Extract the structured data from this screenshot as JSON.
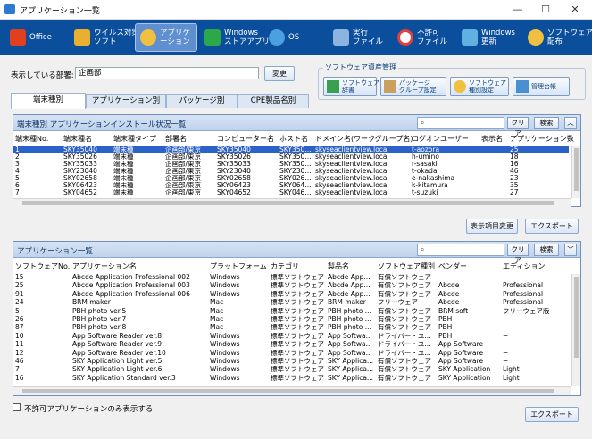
{
  "window": {
    "title": "アプリケーション一覧",
    "controls": [
      "—",
      "☐",
      "✕"
    ]
  },
  "ribbon": [
    {
      "label": "Office",
      "icon": "office-icon",
      "color": "#e04020"
    },
    {
      "label": "ウイルス対策\nソフト",
      "icon": "antivirus-icon",
      "color": "#e8b030"
    },
    {
      "label": "アプリケーション",
      "icon": "application-icon",
      "color": "#f0c040",
      "active": true
    },
    {
      "label": "Windows\nストアアプリ",
      "icon": "store-icon",
      "color": "#2aa84a"
    },
    {
      "label": "OS",
      "icon": "os-icon",
      "color": "#4aa0e0"
    },
    {
      "label": "実行\nファイル",
      "icon": "executable-icon",
      "color": "#8db3e0"
    },
    {
      "label": "不許可\nファイル",
      "icon": "forbidden-icon",
      "color": "#e04040"
    },
    {
      "label": "Windows\n更新",
      "icon": "windows-update-icon",
      "color": "#60b0e0"
    },
    {
      "label": "ソフトウェア\n配布",
      "icon": "distribution-icon",
      "color": "#f0c040"
    }
  ],
  "dept": {
    "label": "表示している部署:",
    "value": "企画部",
    "change_button": "変更"
  },
  "asset": {
    "group_label": "ソフトウェア資産管理",
    "buttons": [
      {
        "label": "ソフトウェア\n辞書",
        "icon": "dictionary-icon"
      },
      {
        "label": "パッケージ\nグループ設定",
        "icon": "package-group-icon"
      },
      {
        "label": "ソフトウェア\n種別設定",
        "icon": "software-type-icon"
      },
      {
        "label": "管理台帳",
        "icon": "ledger-icon"
      }
    ]
  },
  "tabs": [
    "端末種別",
    "アプリケーション別",
    "パッケージ別",
    "CPE製品名別"
  ],
  "top_panel": {
    "title": "端末種別 アプリケーションインストール状況一覧",
    "clear": "クリア",
    "search": "検索",
    "columns": [
      "端末種No.",
      "端末種名",
      "端末種タイプ",
      "部署名",
      "コンピューター名",
      "ホスト名",
      "ドメイン名(ワークグループ名)",
      "ログオンユーザー",
      "表示名",
      "アプリケーション数"
    ],
    "rows": [
      [
        "1",
        "SKY35040",
        "端末種",
        "企画部/東京",
        "SKY35040",
        "SKY350...",
        "skyseaclientview.local",
        "t-aozora",
        "",
        "25"
      ],
      [
        "2",
        "SKY35026",
        "端末種",
        "企画部/東京",
        "SKY35026",
        "SKY350...",
        "skyseaclientview.local",
        "h-umino",
        "",
        "18"
      ],
      [
        "3",
        "SKY35033",
        "端末種",
        "企画部/東京",
        "SKY35033",
        "SKY350...",
        "skyseaclientview.local",
        "r-sasaki",
        "",
        "16"
      ],
      [
        "4",
        "SKY23040",
        "端末種",
        "企画部/東京",
        "SKY23040",
        "SKY230...",
        "skyseaclientview.local",
        "t-okada",
        "",
        "46"
      ],
      [
        "5",
        "SKY02658",
        "端末種",
        "企画部/東京",
        "SKY02658",
        "SKY026...",
        "skyseaclientview.local",
        "e-nakashima",
        "",
        "23"
      ],
      [
        "6",
        "SKY06423",
        "端末種",
        "企画部/東京",
        "SKY06423",
        "SKY064...",
        "skyseaclientview.local",
        "k-kitamura",
        "",
        "35"
      ],
      [
        "7",
        "SKY04652",
        "端末種",
        "企画部/東京",
        "SKY04652",
        "SKY046...",
        "skyseaclientview.local",
        "t-suzuki",
        "",
        "27"
      ]
    ],
    "display_change": "表示項目変更",
    "export": "エクスポート"
  },
  "bottom_panel": {
    "title": "アプリケーション一覧",
    "clear": "クリア",
    "search": "検索",
    "columns": [
      "ソフトウェアNo.",
      "アプリケーション名",
      "プラットフォーム",
      "カテゴリ",
      "製品名",
      "ソフトウェア種別",
      "ベンダー",
      "エディション"
    ],
    "rows": [
      [
        "15",
        "Abcde Application Professional 002",
        "Windows",
        "標準ソフトウェア",
        "Abcde App...",
        "有償ソフトウェア",
        "",
        ""
      ],
      [
        "25",
        "Abcde Application Professional 003",
        "Windows",
        "標準ソフトウェア",
        "Abcde App...",
        "有償ソフトウェア",
        "Abcde",
        "Professional"
      ],
      [
        "91",
        "Abcde Application Professional 006",
        "Windows",
        "標準ソフトウェア",
        "Abcde App...",
        "有償ソフトウェア",
        "Abcde",
        "Professional"
      ],
      [
        "24",
        "BRM maker",
        "Mac",
        "標準ソフトウェア",
        "BRM maker",
        "フリーウェア",
        "Abcde",
        "Professional"
      ],
      [
        "5",
        "PBH photo ver.5",
        "Mac",
        "標準ソフトウェア",
        "PBH photo ...",
        "有償ソフトウェア",
        "BRM soft",
        "フリーウェア版"
      ],
      [
        "26",
        "PBH photo ver.7",
        "Mac",
        "標準ソフトウェア",
        "PBH photo ...",
        "有償ソフトウェア",
        "PBH",
        "−"
      ],
      [
        "87",
        "PBH photo ver.8",
        "Mac",
        "標準ソフトウェア",
        "PBH photo ...",
        "有償ソフトウェア",
        "PBH",
        "−"
      ],
      [
        "10",
        "App Software Reader ver.8",
        "Windows",
        "標準ソフトウェア",
        "App Softwa...",
        "ドライバー・ユ...",
        "PBH",
        "−"
      ],
      [
        "11",
        "App Software Reader ver.9",
        "Windows",
        "標準ソフトウェア",
        "App Softwa...",
        "ドライバー・ユ...",
        "App Software",
        "−"
      ],
      [
        "12",
        "App Software Reader ver.10",
        "Windows",
        "標準ソフトウェア",
        "App Softwa...",
        "ドライバー・ユ...",
        "App Software",
        "−"
      ],
      [
        "46",
        "SKY Application Light ver.5",
        "Windows",
        "標準ソフトウェア",
        "SKY Applica...",
        "有償ソフトウェア",
        "App Software",
        "−"
      ],
      [
        "7",
        "SKY Application Light ver.6",
        "Windows",
        "標準ソフトウェア",
        "SKY Applica...",
        "有償ソフトウェア",
        "SKY Application",
        "Light"
      ],
      [
        "16",
        "SKY Application Standard ver.3",
        "Windows",
        "標準ソフトウェア",
        "SKY Applica...",
        "有償ソフトウェア",
        "SKY Application",
        "Light"
      ]
    ],
    "export": "エクスポート"
  },
  "filter_checkbox": "不許可アプリケーションのみ表示する"
}
